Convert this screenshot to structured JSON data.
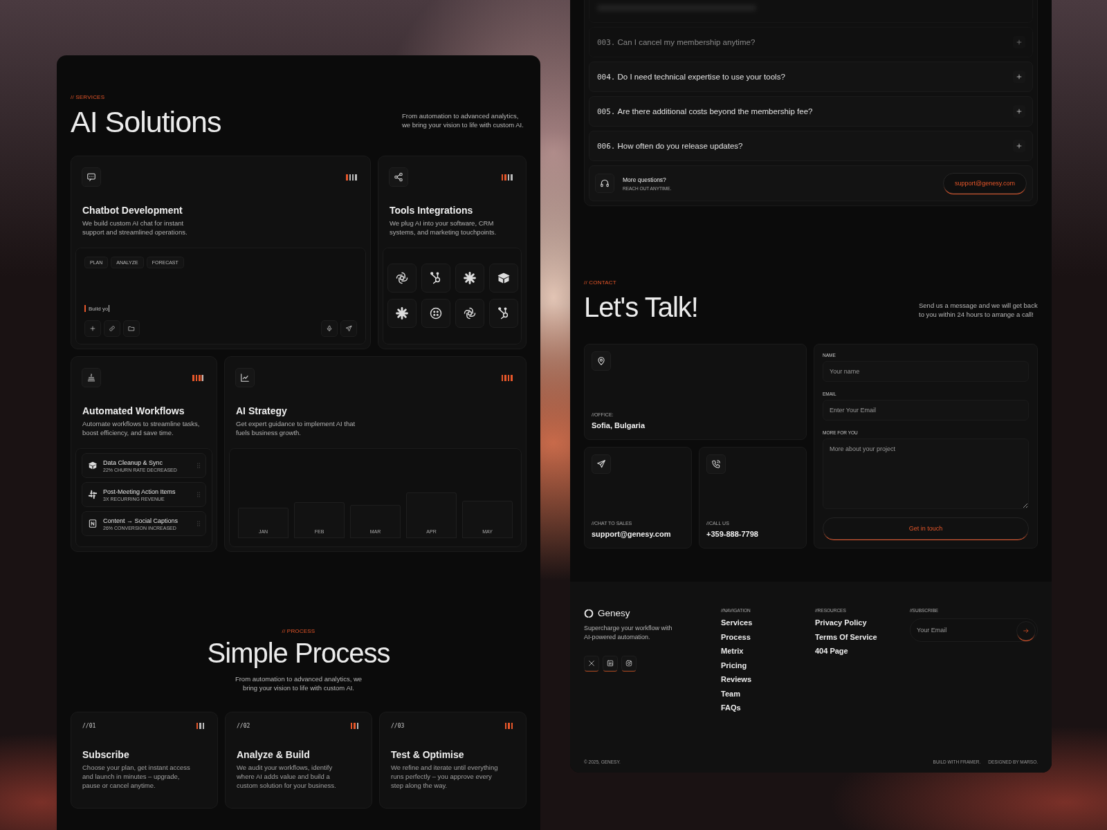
{
  "services": {
    "eyebrow": "// SERVICES",
    "title": "AI Solutions",
    "description": "From automation to advanced analytics, we bring your vision to life with custom AI.",
    "cards": [
      {
        "kind": "chat",
        "title": "Chatbot Development",
        "description": "We build custom AI chat for instant support and streamlined operations.",
        "level": 0.25,
        "tags": [
          "PLAN",
          "ANALYZE",
          "FORECAST"
        ],
        "input_value": "Build yo"
      },
      {
        "kind": "integrations",
        "title": "Tools Integrations",
        "description": "We plug AI into your software, CRM systems, and marketing touchpoints.",
        "level": 0.5
      },
      {
        "kind": "workflows",
        "title": "Automated Workflows",
        "description": "Automate workflows to streamline tasks, boost efficiency, and save time.",
        "level": 0.75,
        "items": [
          {
            "title": "Data Cleanup & Sync",
            "subtitle": "22% CHURN RATE DECREASED"
          },
          {
            "title": "Post-Meeting Action Items",
            "subtitle": "3X RECURRING REVENUE"
          },
          {
            "title": "Content → Social Captions",
            "subtitle": "26% CONVERSION INCREASED"
          }
        ]
      },
      {
        "kind": "strategy",
        "title": "AI Strategy",
        "description": "Get expert guidance to implement AI that fuels business growth.",
        "level": 1,
        "months": [
          "JAN",
          "FEB",
          "MAR",
          "APR",
          "MAY"
        ]
      }
    ]
  },
  "process": {
    "eyebrow": "// PROCESS",
    "title": "Simple Process",
    "description": "From automation to advanced analytics, we bring your vision to life with custom AI.",
    "steps": [
      {
        "number": "//01",
        "title": "Subscribe",
        "description": "Choose your plan, get instant access and launch in minutes – upgrade, pause or cancel anytime.",
        "level": 0.33
      },
      {
        "number": "//02",
        "title": "Analyze & Build",
        "description": "We audit your workflows, identify where AI adds value and build a custom solution for your business.",
        "level": 0.67
      },
      {
        "number": "//03",
        "title": "Test & Optimise",
        "description": "We refine and iterate until everything runs perfectly – you approve every step along the way.",
        "level": 1
      }
    ]
  },
  "faq": {
    "items": [
      {
        "number": "003.",
        "question": "Can I cancel my membership anytime?",
        "expanded": false,
        "blurred": true
      },
      {
        "number": "004.",
        "question": "Do I need technical expertise to use your tools?",
        "expanded": false,
        "blurred": false
      },
      {
        "number": "005.",
        "question": "Are there additional costs beyond the membership fee?",
        "expanded": false,
        "blurred": false
      },
      {
        "number": "006.",
        "question": "How often do you release updates?",
        "expanded": false,
        "blurred": false
      }
    ],
    "more": {
      "title": "More questions?",
      "subtitle": "REACH OUT ANYTIME.",
      "email": "support@genesy.com"
    }
  },
  "contact": {
    "eyebrow": "// CONTACT",
    "title": "Let's Talk!",
    "description": "Send us a message and we will get back to you within 24 hours to arrange a call!",
    "cards": [
      {
        "label": "//OFFICE:",
        "value": "Sofia, Bulgaria"
      },
      {
        "label": "//CHAT TO SALES",
        "value": "support@genesy.com"
      },
      {
        "label": "//CALL US",
        "value": "+359-888-7798"
      }
    ],
    "form": {
      "fields": [
        {
          "kind": "input",
          "label": "NAME",
          "placeholder": "Your name"
        },
        {
          "kind": "input",
          "label": "EMAIL",
          "placeholder": "Enter Your Email"
        },
        {
          "kind": "textarea",
          "label": "MORE FOR YOU",
          "placeholder": "More about your project"
        }
      ],
      "button": "Get in touch"
    }
  },
  "footer": {
    "brand": "Genesy",
    "tagline": "Supercharge your workflow with AI-powered automation.",
    "columns": [
      {
        "heading": "//NAVIGATION",
        "links": [
          "Services",
          "Process",
          "Metrix",
          "Pricing",
          "Reviews",
          "Team",
          "FAQs"
        ]
      },
      {
        "heading": "//RESOURCES",
        "links": [
          "Privacy Policy",
          "Terms Of Service",
          "404 Page"
        ]
      }
    ],
    "subscribe": {
      "heading": "//SUBSCRIBE",
      "placeholder": "Your Email"
    },
    "copyright": "© 2025, GENESY.",
    "credits": [
      "BUILD WITH FRAMER.",
      "DESIGNED BY MARSO."
    ]
  }
}
